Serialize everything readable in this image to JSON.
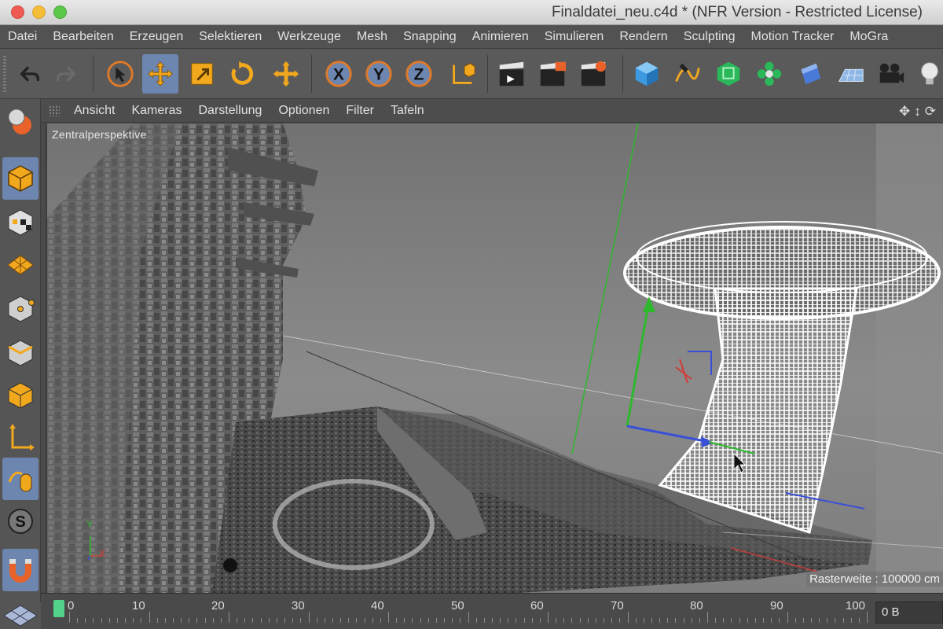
{
  "window": {
    "title": "Finaldatei_neu.c4d * (NFR Version - Restricted License)"
  },
  "menubar": {
    "items": [
      "Datei",
      "Bearbeiten",
      "Erzeugen",
      "Selektieren",
      "Werkzeuge",
      "Mesh",
      "Snapping",
      "Animieren",
      "Simulieren",
      "Rendern",
      "Sculpting",
      "Motion Tracker",
      "MoGra"
    ]
  },
  "toolbar": {
    "tools": [
      "undo-icon",
      "redo-icon",
      "select-cursor-icon",
      "move-icon",
      "scale-icon",
      "rotate-icon",
      "live-select-icon",
      "x-axis-icon",
      "y-axis-icon",
      "z-axis-icon",
      "world-coordinate-icon",
      "render-view-icon",
      "render-picture-viewer-icon",
      "render-settings-icon",
      "cube-primitive-icon",
      "spline-pen-icon",
      "subdivision-surface-icon",
      "cloner-icon",
      "deformer-icon",
      "floor-icon",
      "camera-icon",
      "light-icon"
    ],
    "active_tools": [
      "move-icon"
    ]
  },
  "leftbar": {
    "tools": [
      "polygon-objects-icon",
      "model-mode-icon",
      "texture-mode-icon",
      "workplane-mode-icon",
      "points-mode-icon",
      "edges-mode-icon",
      "polygons-mode-icon",
      "axis-mode-icon",
      "tweak-mode-icon",
      "solo-mode-icon",
      "snapping-icon",
      "layout-icon"
    ],
    "active_tools": [
      "model-mode-icon"
    ]
  },
  "viewport": {
    "menu": [
      "Ansicht",
      "Kameras",
      "Darstellung",
      "Optionen",
      "Filter",
      "Tafeln"
    ],
    "projection_label": "Zentralperspektive",
    "grid_label": "Rasterweite : 100000 cm",
    "axis_labels": {
      "y": "Y",
      "x": "X"
    }
  },
  "timeline": {
    "ticks": [
      "0",
      "10",
      "20",
      "30",
      "40",
      "50",
      "60",
      "70",
      "80",
      "90",
      "100"
    ],
    "current_frame_value": "0 B"
  },
  "colors": {
    "accent_active": "#6d86b0",
    "axis_y": "#2eb82e",
    "axis_x": "#d23c3c",
    "axis_z": "#3a4fd8",
    "timeline_cursor": "#52d28a"
  }
}
